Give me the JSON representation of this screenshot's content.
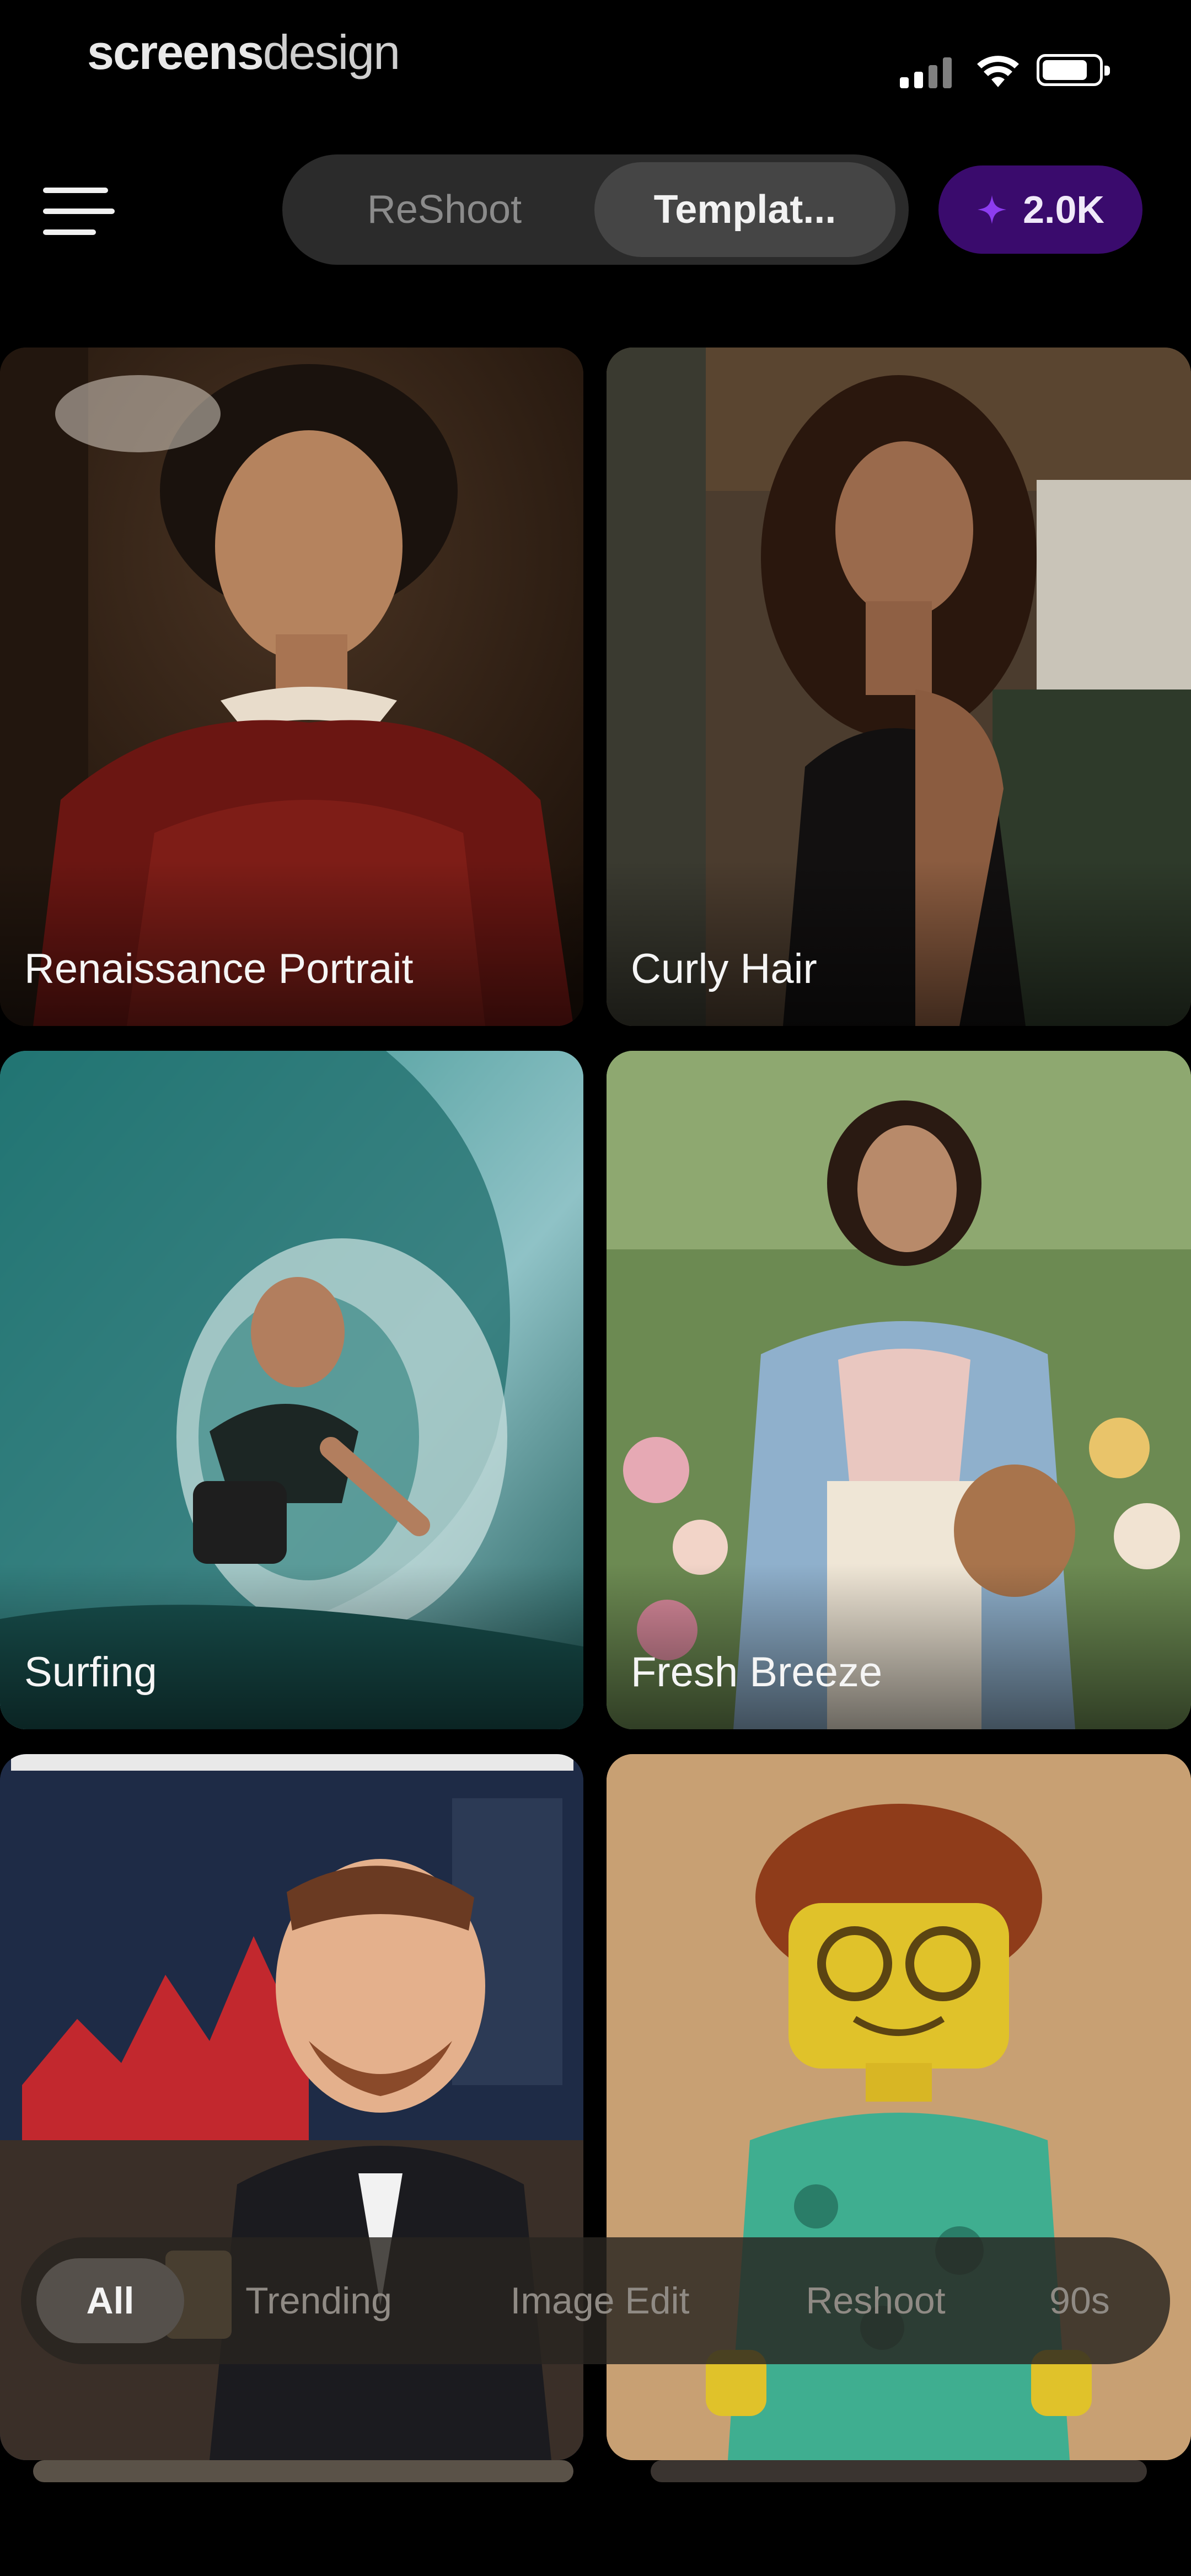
{
  "status_bar": {
    "brand_bold": "screens",
    "brand_light": "design"
  },
  "header": {
    "segments": [
      {
        "label": "ReShoot",
        "selected": false
      },
      {
        "label": "Templat...",
        "selected": true
      }
    ],
    "credits": "2.0K",
    "accent_color": "#3a0b6d"
  },
  "templates": [
    {
      "label": "Renaissance Portrait"
    },
    {
      "label": "Curly Hair"
    },
    {
      "label": "Surfing"
    },
    {
      "label": "Fresh Breeze"
    },
    {
      "label": ""
    },
    {
      "label": ""
    }
  ],
  "categories": [
    {
      "label": "All",
      "selected": true
    },
    {
      "label": "Trending",
      "selected": false
    },
    {
      "label": "Image Edit",
      "selected": false
    },
    {
      "label": "Reshoot",
      "selected": false
    },
    {
      "label": "90s",
      "selected": false
    }
  ],
  "icons": [
    "menu-icon",
    "sparkle-icon",
    "signal-icon",
    "wifi-icon",
    "battery-icon"
  ]
}
